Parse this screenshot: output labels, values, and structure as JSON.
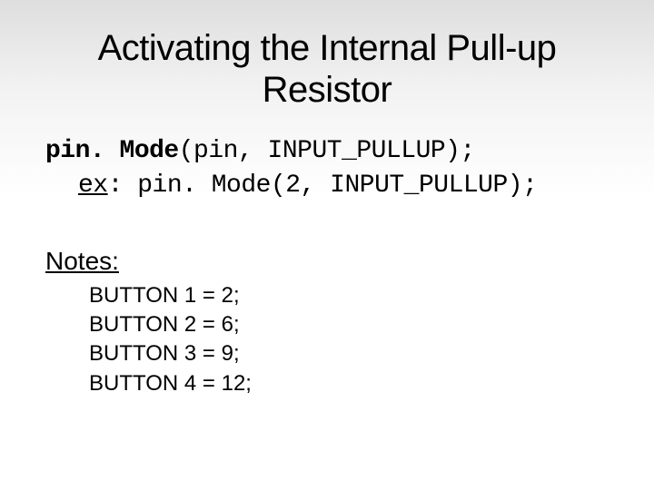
{
  "title": "Activating the Internal Pull-up Resistor",
  "code": {
    "func": "pin. Mode",
    "args1": "(pin, INPUT_PULLUP);",
    "ex_label": "ex",
    "ex_colon": ": ",
    "ex_call": "pin. Mode(2, INPUT_PULLUP);"
  },
  "notes": {
    "heading": "Notes:",
    "items": [
      "BUTTON 1 = 2;",
      "BUTTON 2 = 6;",
      "BUTTON 3 = 9;",
      "BUTTON 4 = 12;"
    ]
  }
}
